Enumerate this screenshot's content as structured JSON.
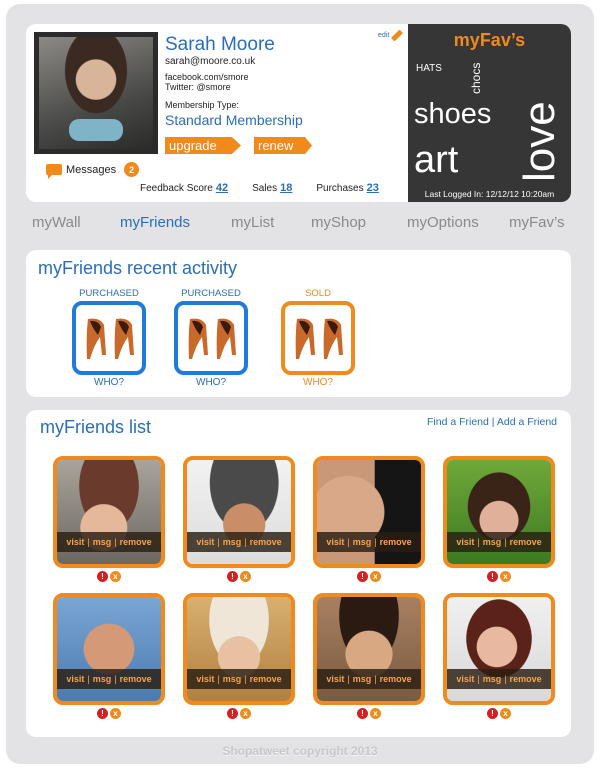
{
  "profile": {
    "name": "Sarah Moore",
    "email": "sarah@moore.co.uk",
    "facebook": "facebook.com/smore",
    "twitter": "Twitter: @smore",
    "membership_label": "Membership Type:",
    "membership": "Standard Membership",
    "upgrade_label": "upgrade",
    "renew_label": "renew",
    "edit_label": "edit",
    "messages_label": "Messages",
    "messages_count": "2"
  },
  "stats": {
    "feedback_label": "Feedback Score",
    "feedback_value": "42",
    "sales_label": "Sales",
    "sales_value": "18",
    "purchases_label": "Purchases",
    "purchases_value": "23"
  },
  "fav": {
    "title": "myFav’s",
    "words": {
      "hats": "HATS",
      "chocs": "chocs",
      "shoes": "shoes",
      "art": "art",
      "love": "love"
    },
    "last_logged": "Last Logged In: 12/12/12 10:20am"
  },
  "nav": {
    "items": [
      {
        "label": "myWall"
      },
      {
        "label": "myFriends"
      },
      {
        "label": "myList"
      },
      {
        "label": "myShop"
      },
      {
        "label": "myOptions"
      },
      {
        "label": "myFav’s"
      }
    ]
  },
  "activity": {
    "title": "myFriends recent activity",
    "items": [
      {
        "status": "PURCHASED",
        "who": "WHO?"
      },
      {
        "status": "PURCHASED",
        "who": "WHO?"
      },
      {
        "status": "SOLD",
        "who": "WHO?"
      }
    ]
  },
  "friends": {
    "title": "myFriends list",
    "find_label": "Find a Friend",
    "divider": "|",
    "add_label": "Add a Friend",
    "actions": {
      "visit": "visit",
      "msg": "msg",
      "remove": "remove",
      "sep": "|"
    },
    "icon_glyphs": {
      "alert": "!",
      "close": "x"
    }
  },
  "footer": "Shopatweet copyright 2013",
  "colors": {
    "accent": "#f18a1c",
    "blue": "#2a6ebb",
    "dark_panel": "#363636",
    "frame": "#e3e3e6"
  }
}
